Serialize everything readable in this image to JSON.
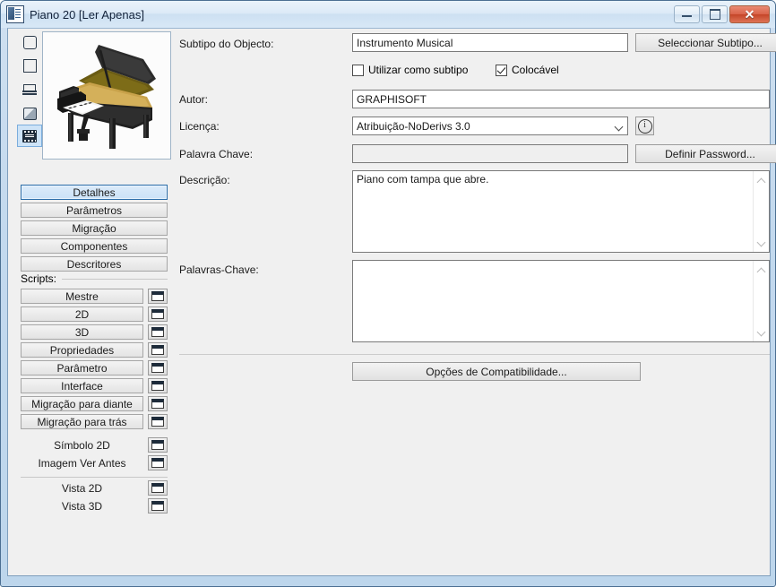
{
  "window": {
    "title": "Piano 20 [Ler Apenas]",
    "icon": "object-settings-icon",
    "controls": {
      "minimize": "minimize-button",
      "maximize": "maximize-button",
      "close_glyph": "✕"
    }
  },
  "left": {
    "rail_icons": [
      {
        "name": "rounded-rect-icon",
        "selected": false
      },
      {
        "name": "square-icon",
        "selected": false
      },
      {
        "name": "slab-icon",
        "selected": false
      },
      {
        "name": "cube-icon",
        "selected": false
      },
      {
        "name": "film-strip-icon",
        "selected": true
      }
    ],
    "preview_alt": "grand-piano-preview",
    "tabs": [
      {
        "label": "Detalhes",
        "active": true
      },
      {
        "label": "Parâmetros",
        "active": false
      },
      {
        "label": "Migração",
        "active": false
      },
      {
        "label": "Componentes",
        "active": false
      },
      {
        "label": "Descritores",
        "active": false
      }
    ],
    "scripts_label": "Scripts:",
    "scripts": [
      "Mestre",
      "2D",
      "3D",
      "Propriedades",
      "Parâmetro",
      "Interface",
      "Migração para diante",
      "Migração para trás"
    ],
    "views_upper": [
      "Símbolo 2D",
      "Imagem Ver Antes"
    ],
    "views_lower": [
      "Vista 2D",
      "Vista 3D"
    ]
  },
  "main": {
    "subtype": {
      "label": "Subtipo do Objecto:",
      "value": "Instrumento Musical",
      "button": "Seleccionar Subtipo...",
      "checkbox_use_as_subtype": {
        "label": "Utilizar como subtipo",
        "checked": false
      },
      "checkbox_placeable": {
        "label": "Colocável",
        "checked": true
      }
    },
    "author": {
      "label": "Autor:",
      "value": "GRAPHISOFT"
    },
    "license": {
      "label": "Licença:",
      "value": "Atribuição-NoDerivs 3.0",
      "info_icon": "info-circle-icon"
    },
    "password": {
      "label": "Palavra Chave:",
      "value": "",
      "button": "Definir Password..."
    },
    "description": {
      "label": "Descrição:",
      "value": "Piano com tampa que abre."
    },
    "keywords": {
      "label": "Palavras-Chave:",
      "value": ""
    },
    "compatibility_button": "Opções de Compatibilidade..."
  },
  "colors": {
    "accent": "#2a6ca8",
    "title_bg": "#dceaf7",
    "client_bg": "#f0f0f0",
    "close_red": "#c44528"
  }
}
